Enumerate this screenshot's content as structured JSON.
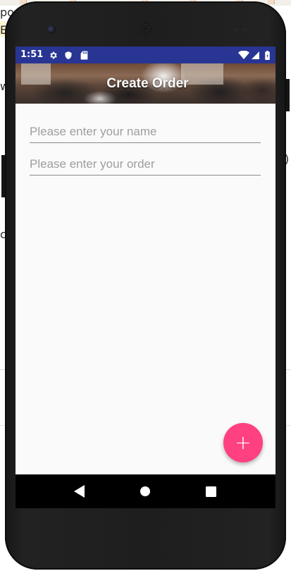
{
  "background": {
    "fragments": [
      "po",
      "E",
      "w",
      "c",
      ")"
    ]
  },
  "status_bar": {
    "time": "1:51",
    "icons": [
      "gear-icon",
      "shield-icon",
      "sd-card-icon",
      "wifi-icon",
      "signal-icon",
      "battery-icon"
    ]
  },
  "app_bar": {
    "title": "Create Order"
  },
  "form": {
    "name_field": {
      "value": "",
      "placeholder": "Please enter your name"
    },
    "order_field": {
      "value": "",
      "placeholder": "Please enter your order"
    }
  },
  "fab": {
    "label": "+",
    "icon": "plus-icon"
  },
  "nav_bar": {
    "buttons": [
      "back-icon",
      "home-icon",
      "recents-icon"
    ]
  },
  "colors": {
    "status_bar": "#283593",
    "accent": "#ff4081",
    "screen_background": "#fafafa",
    "nav_bar": "#000000"
  }
}
